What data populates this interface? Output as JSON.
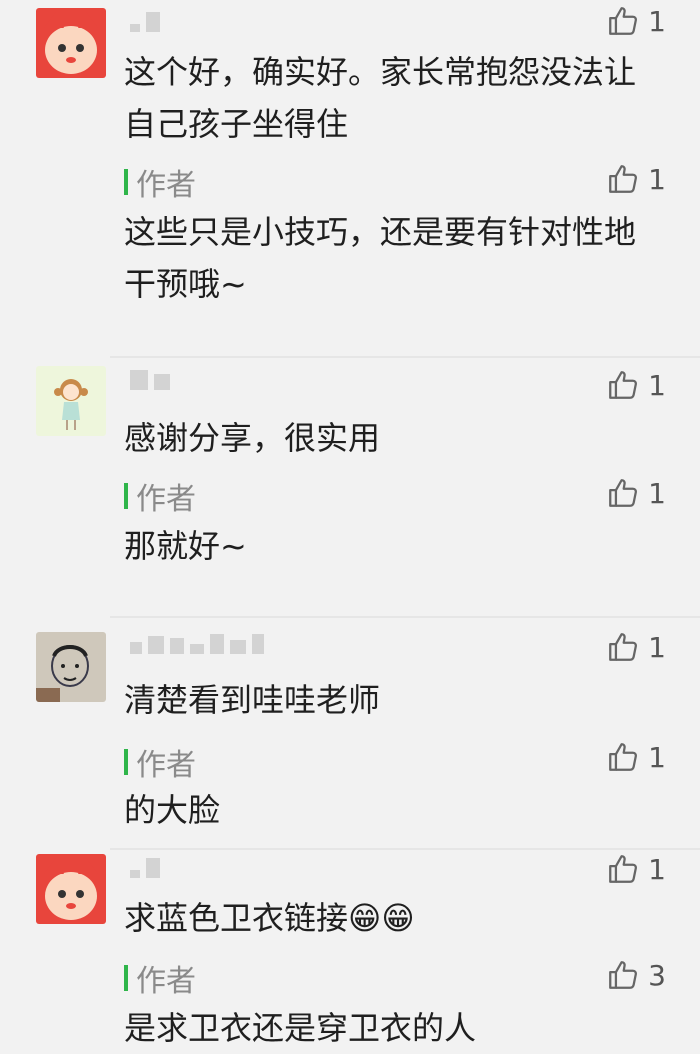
{
  "comments": [
    {
      "text": "这个好，确实好。家长常抱怨没法让自己孩子坐得住",
      "likes": "1",
      "reply": {
        "author_label": "作者",
        "text": "这些只是小技巧，还是要有针对性地干预哦~",
        "likes": "1"
      }
    },
    {
      "text": "感谢分享，很实用",
      "likes": "1",
      "reply": {
        "author_label": "作者",
        "text": "那就好~",
        "likes": "1"
      }
    },
    {
      "text": "清楚看到哇哇老师",
      "likes": "1",
      "reply": {
        "author_label": "作者",
        "text": "的大脸",
        "likes": "1"
      }
    },
    {
      "text": "求蓝色卫衣链接😁😁",
      "likes": "1",
      "reply": {
        "author_label": "作者",
        "text": "是求卫衣还是穿卫衣的人",
        "likes": "3"
      }
    }
  ],
  "colors": {
    "background": "#f2f2f2",
    "author_bar": "#2fb54a",
    "author_label": "#8a8a8a",
    "comment_text": "#1f1f1f"
  },
  "icons": [
    "thumbs-up-icon"
  ]
}
